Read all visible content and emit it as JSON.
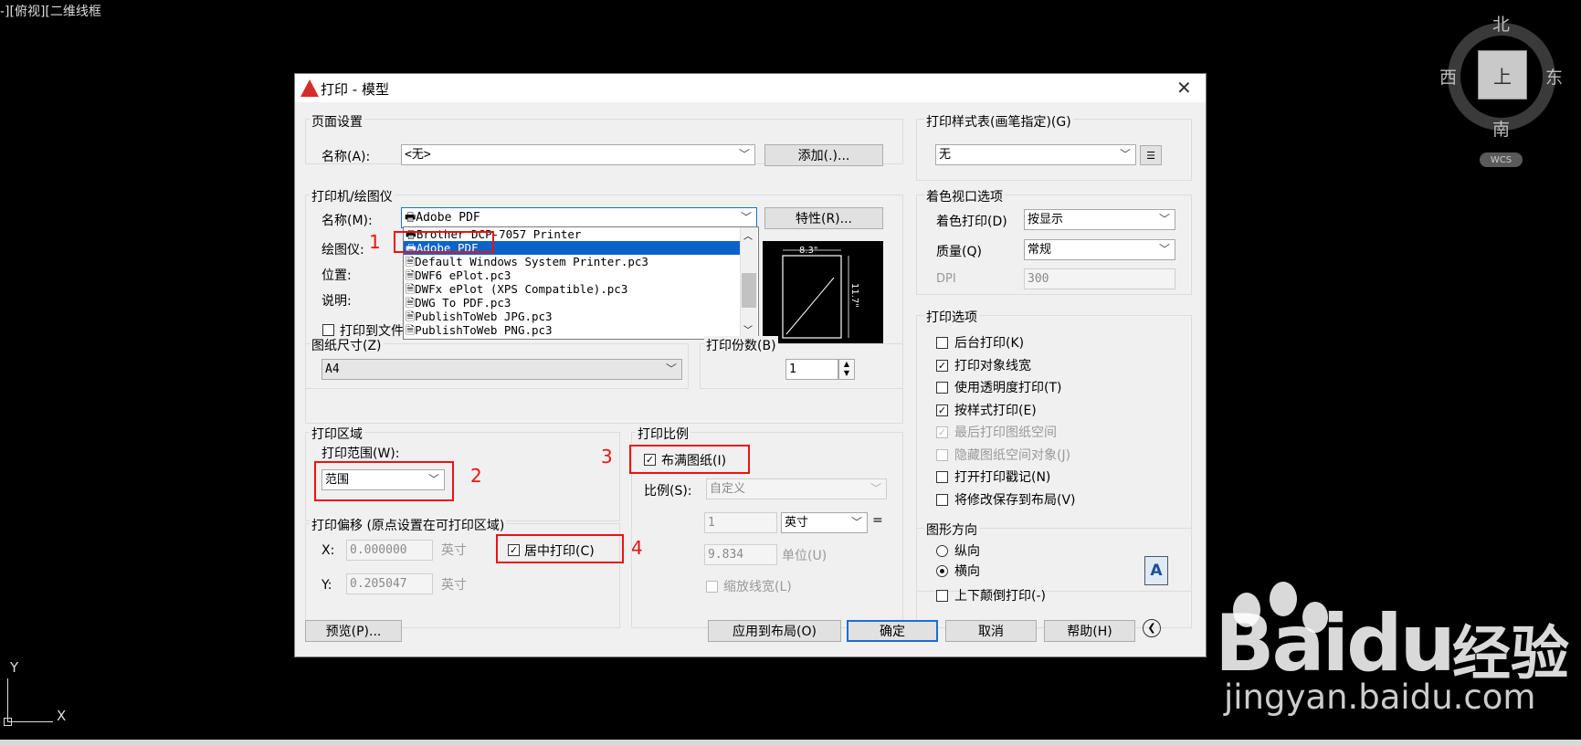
{
  "viewport": {
    "label": "-][俯视][二维线框"
  },
  "viewcube": {
    "north": "北",
    "south": "南",
    "west": "西",
    "east": "东",
    "face": "上",
    "wcs": "WCS"
  },
  "ucs": {
    "y": "Y",
    "x": "X"
  },
  "watermark": {
    "brand": "Bai",
    "brand2": "du",
    "cn": "经验",
    "url": "jingyan.baidu.com"
  },
  "dialog": {
    "title": "打印 - 模型",
    "page_setup": {
      "legend": "页面设置",
      "name_label": "名称(A):",
      "name_value": "<无>",
      "add_button": "添加(.)..."
    },
    "printer": {
      "legend": "打印机/绘图仪",
      "name_label": "名称(M):",
      "name_value": "Adobe PDF",
      "properties_button": "特性(R)...",
      "plotter_label": "绘图仪:",
      "location_label": "位置:",
      "description_label": "说明:",
      "print_to_file": "打印到文件",
      "dropdown_items": [
        "Brother DCP-7057 Printer",
        "Adobe PDF",
        "Default Windows System Printer.pc3",
        "DWF6 ePlot.pc3",
        "DWFx ePlot (XPS Compatible).pc3",
        "DWG To PDF.pc3",
        "PublishToWeb JPG.pc3",
        "PublishToWeb PNG.pc3"
      ],
      "selected_index": 1,
      "preview_width": "8.3\"",
      "preview_height": "11.7\""
    },
    "paper_size": {
      "legend": "图纸尺寸(Z)",
      "value": "A4"
    },
    "copies": {
      "legend": "打印份数(B)",
      "value": "1"
    },
    "plot_area": {
      "legend": "打印区域",
      "range_label": "打印范围(W):",
      "range_value": "范围"
    },
    "plot_offset": {
      "legend": "打印偏移 (原点设置在可打印区域)",
      "x_label": "X:",
      "x_value": "0.000000",
      "x_unit": "英寸",
      "y_label": "Y:",
      "y_value": "0.205047",
      "y_unit": "英寸",
      "center": "居中打印(C)"
    },
    "plot_scale": {
      "legend": "打印比例",
      "fit": "布满图纸(I)",
      "scale_label": "比例(S):",
      "scale_value": "自定义",
      "num_value": "1",
      "num_unit": "英寸",
      "equals": "=",
      "den_value": "9.834",
      "den_unit": "单位(U)",
      "scale_lineweights": "缩放线宽(L)"
    },
    "style_table": {
      "legend": "打印样式表(画笔指定)(G)",
      "value": "无"
    },
    "shaded_viewport": {
      "legend": "着色视口选项",
      "shade_label": "着色打印(D)",
      "shade_value": "按显示",
      "quality_label": "质量(Q)",
      "quality_value": "常规",
      "dpi_label": "DPI",
      "dpi_value": "300"
    },
    "plot_options": {
      "legend": "打印选项",
      "items": [
        {
          "label": "后台打印(K)",
          "checked": false,
          "disabled": false
        },
        {
          "label": "打印对象线宽",
          "checked": true,
          "disabled": false
        },
        {
          "label": "使用透明度打印(T)",
          "checked": false,
          "disabled": false
        },
        {
          "label": "按样式打印(E)",
          "checked": true,
          "disabled": false
        },
        {
          "label": "最后打印图纸空间",
          "checked": true,
          "disabled": true
        },
        {
          "label": "隐藏图纸空间对象(J)",
          "checked": false,
          "disabled": true
        },
        {
          "label": "打开打印戳记(N)",
          "checked": false,
          "disabled": false
        },
        {
          "label": "将修改保存到布局(V)",
          "checked": false,
          "disabled": false
        }
      ]
    },
    "orientation": {
      "legend": "图形方向",
      "portrait": "纵向",
      "landscape": "横向",
      "upside_down": "上下颠倒打印(-)",
      "icon_letter": "A"
    },
    "buttons": {
      "preview": "预览(P)...",
      "apply": "应用到布局(O)",
      "ok": "确定",
      "cancel": "取消",
      "help": "帮助(H)"
    },
    "annotations": [
      "1",
      "2",
      "3",
      "4"
    ]
  }
}
